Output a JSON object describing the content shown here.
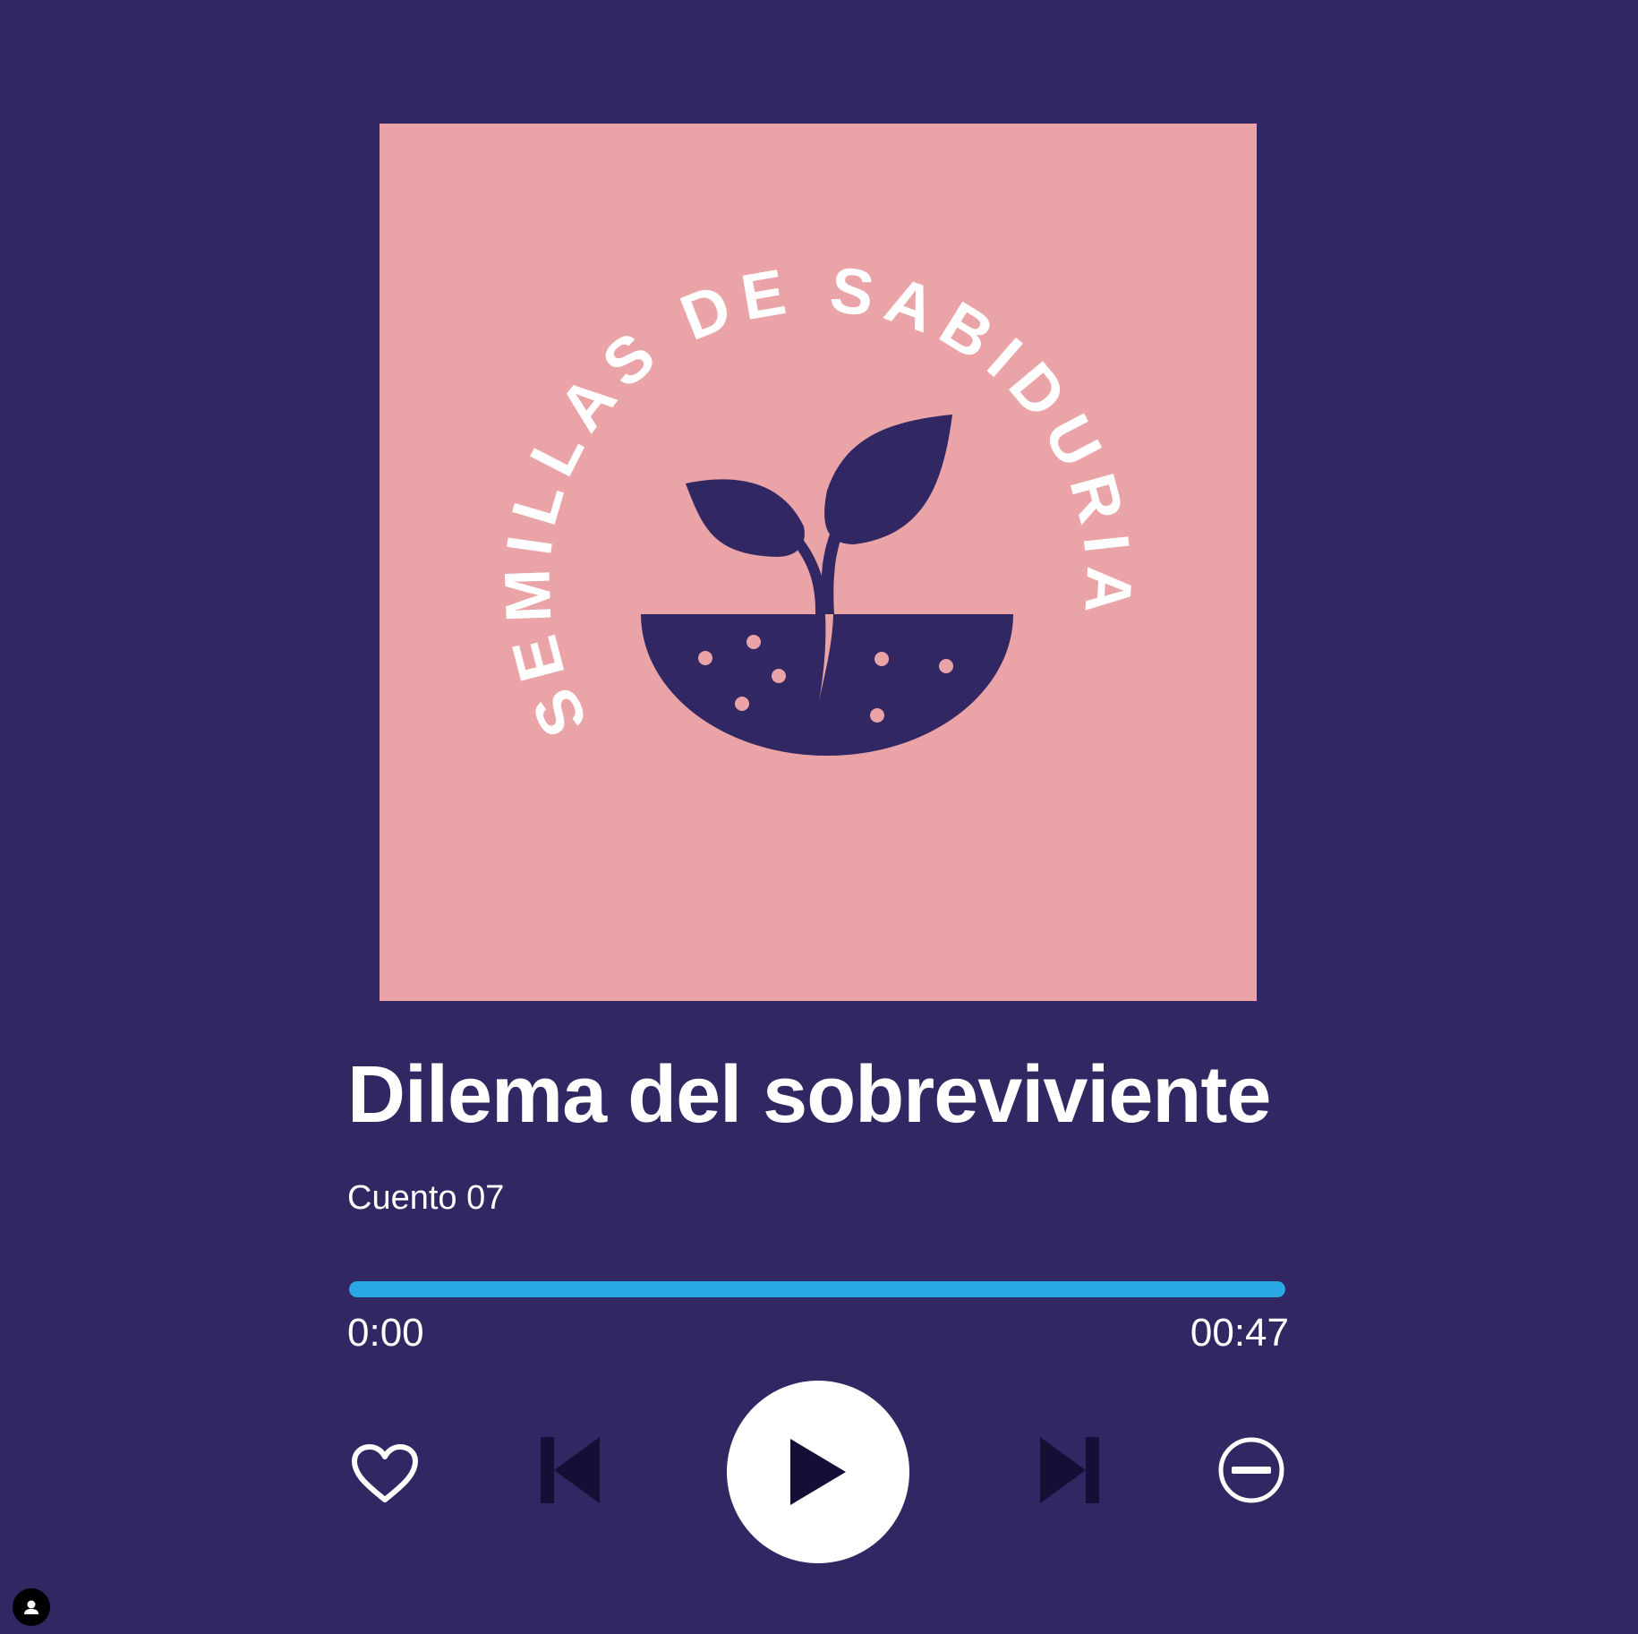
{
  "track": {
    "title": "Dilema del sobreviviente",
    "subtitle": "Cuento 07"
  },
  "cover": {
    "logo_text": "SEMILLAS DE SABIDURIA",
    "background": "#eaa3a6",
    "ink": "#312763"
  },
  "progress": {
    "fraction": 1.0,
    "elapsed_label": "0:00",
    "duration_label": "00:47",
    "color": "#29a8e3"
  },
  "controls": {
    "favorite": "heart-icon",
    "previous": "skip-previous-icon",
    "play": "play-icon",
    "next": "skip-next-icon",
    "remove": "remove-circle-icon"
  },
  "colors": {
    "background": "#312763",
    "text": "#ffffff",
    "control_dark": "#140f35"
  },
  "avatar": {
    "icon": "person-icon"
  }
}
